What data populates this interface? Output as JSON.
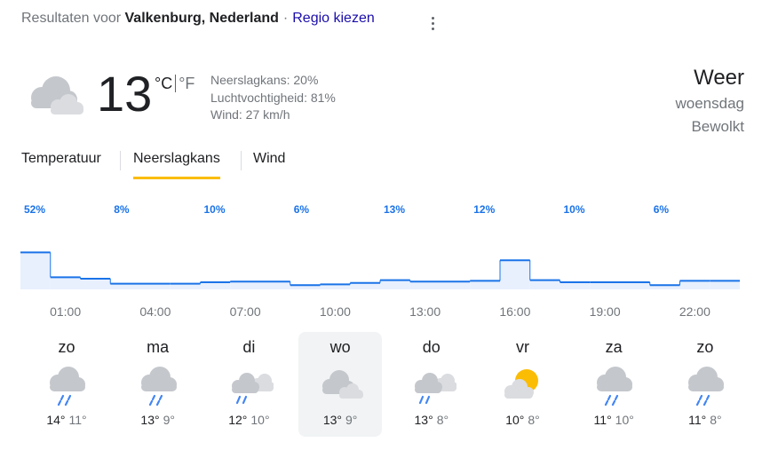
{
  "header": {
    "prefix": "Resultaten voor",
    "location": "Valkenburg, Nederland",
    "separator": "·",
    "region_link": "Regio kiezen"
  },
  "current": {
    "temperature": "13",
    "unit_c": "°C",
    "unit_f": "°F",
    "icon": "cloudy-icon",
    "precipitation": "Neerslagkans: 20%",
    "humidity": "Luchtvochtigheid: 81%",
    "wind": "Wind: 27 km/h"
  },
  "side": {
    "title": "Weer",
    "day": "woensdag",
    "condition": "Bewolkt"
  },
  "tabs": [
    {
      "label": "Temperatuur",
      "active": false
    },
    {
      "label": "Neerslagkans",
      "active": true
    },
    {
      "label": "Wind",
      "active": false
    }
  ],
  "chart_data": {
    "type": "area",
    "title": "",
    "xlabel": "",
    "ylabel": "",
    "ylim": [
      0,
      100
    ],
    "x": [
      "01:00",
      "02:00",
      "03:00",
      "04:00",
      "05:00",
      "06:00",
      "07:00",
      "08:00",
      "09:00",
      "10:00",
      "11:00",
      "12:00",
      "13:00",
      "14:00",
      "15:00",
      "16:00",
      "17:00",
      "18:00",
      "19:00",
      "20:00",
      "21:00",
      "22:00",
      "23:00",
      "00:00"
    ],
    "values": [
      52,
      17,
      15,
      8,
      8,
      8,
      10,
      11,
      11,
      6,
      7,
      9,
      13,
      11,
      11,
      12,
      41,
      13,
      10,
      10,
      10,
      6,
      12,
      12
    ],
    "labels": [
      {
        "index": 0,
        "text": "52%"
      },
      {
        "index": 3,
        "text": "8%"
      },
      {
        "index": 6,
        "text": "10%"
      },
      {
        "index": 9,
        "text": "6%"
      },
      {
        "index": 12,
        "text": "13%"
      },
      {
        "index": 15,
        "text": "12%"
      },
      {
        "index": 18,
        "text": "10%"
      },
      {
        "index": 21,
        "text": "6%"
      }
    ],
    "time_ticks": [
      "01:00",
      "04:00",
      "07:00",
      "10:00",
      "13:00",
      "16:00",
      "19:00",
      "22:00"
    ],
    "colors": {
      "line": "#1a73e8",
      "fill": "#e8f0fe",
      "label": "#1a73e8",
      "tick": "#70757a"
    }
  },
  "days": [
    {
      "name": "zo",
      "icon": "rain-icon",
      "high": "14°",
      "low": "11°"
    },
    {
      "name": "ma",
      "icon": "rain-icon",
      "high": "13°",
      "low": "9°"
    },
    {
      "name": "di",
      "icon": "rain-cloud-icon",
      "high": "12°",
      "low": "10°"
    },
    {
      "name": "wo",
      "icon": "cloudy-icon",
      "high": "13°",
      "low": "9°"
    },
    {
      "name": "do",
      "icon": "rain-cloud-icon",
      "high": "13°",
      "low": "8°"
    },
    {
      "name": "vr",
      "icon": "partly-cloudy-icon",
      "high": "10°",
      "low": "8°"
    },
    {
      "name": "za",
      "icon": "rain-icon",
      "high": "11°",
      "low": "10°"
    },
    {
      "name": "zo",
      "icon": "rain-icon",
      "high": "11°",
      "low": "8°"
    }
  ],
  "selected_day_index": 3
}
